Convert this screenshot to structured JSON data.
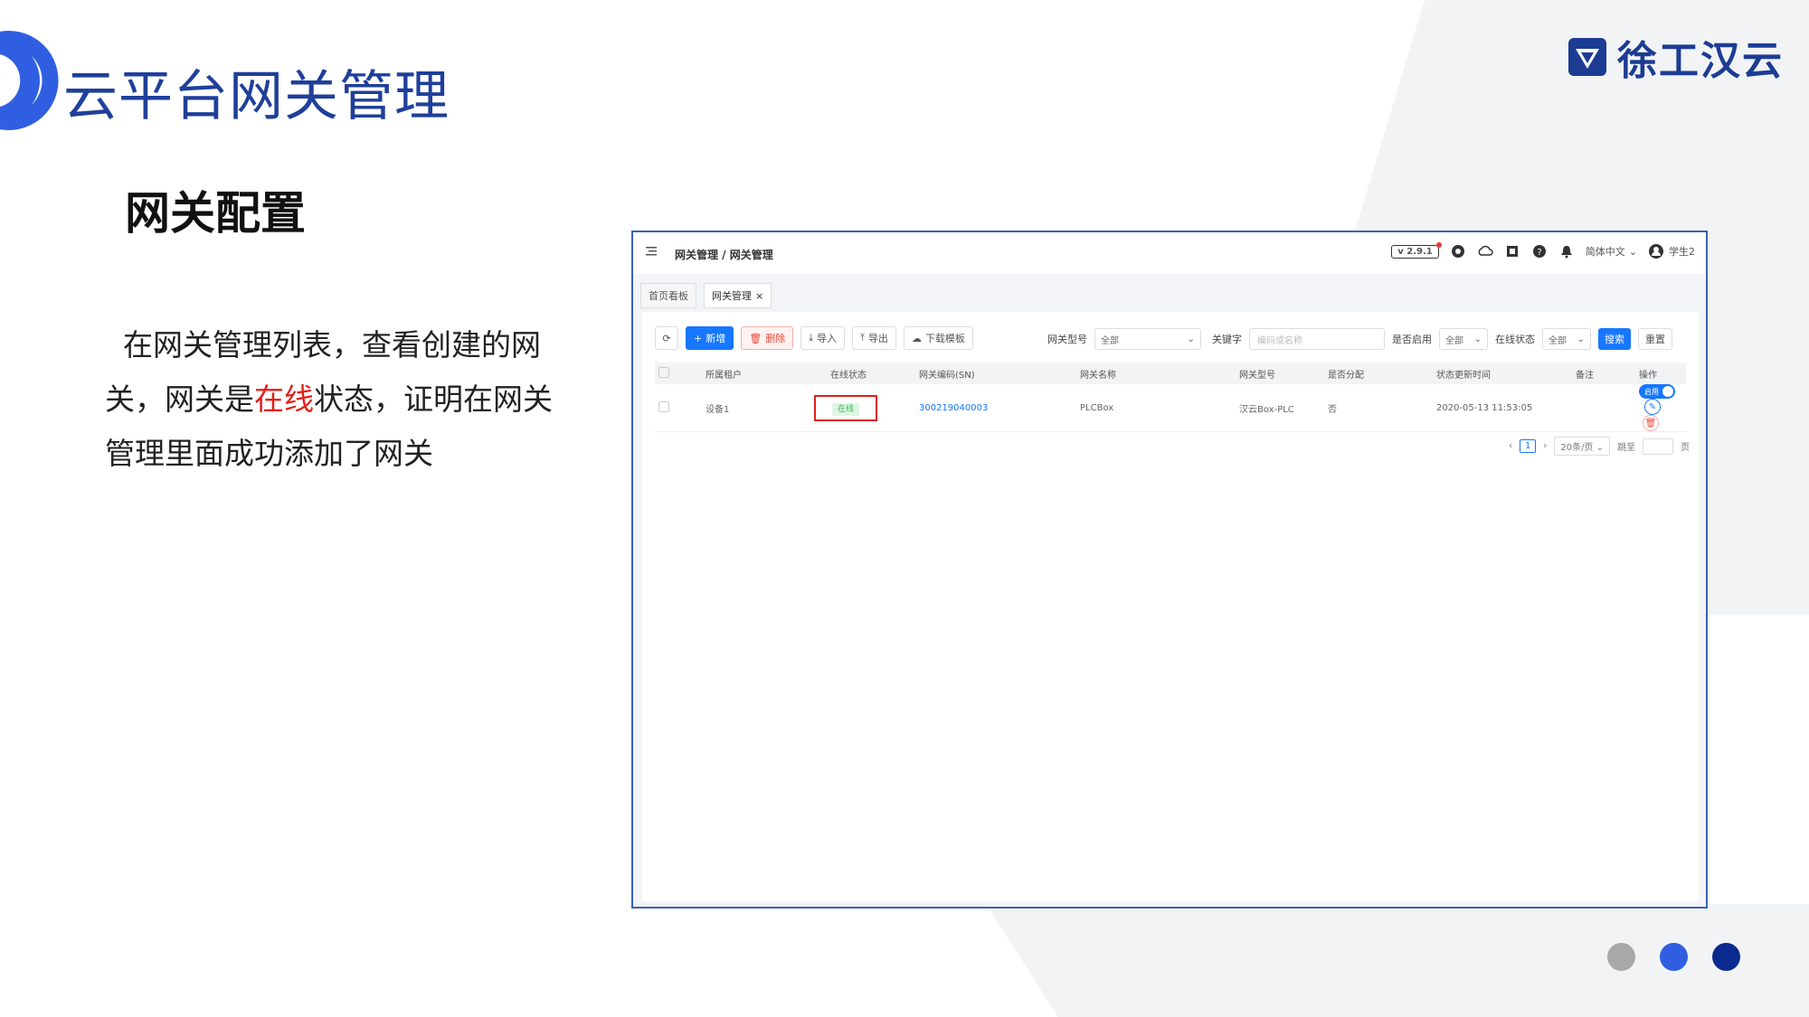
{
  "slide": {
    "title": "云平台网关管理",
    "brand": "徐工汉云",
    "section_heading": "网关配置",
    "body_before": "在网关管理列表，查看创建的网关，网关是",
    "body_highlight": "在线",
    "body_after": "状态，证明在网关管理里面成功添加了网关",
    "colors": {
      "accent": "#2f5fe0",
      "title": "#1f3f9a",
      "highlight": "#e0201a",
      "dot_gray": "#a8a8a8",
      "dot_blue": "#2f5fe0",
      "dot_navy": "#0b2a8f"
    }
  },
  "app": {
    "breadcrumb": "网关管理 / 网关管理",
    "version": "v 2.9.1",
    "language": "简体中文",
    "user": "学生2",
    "tabs": [
      {
        "label": "首页看板"
      },
      {
        "label": "网关管理"
      }
    ],
    "toolbar": {
      "add": "新增",
      "delete": "删除",
      "import": "导入",
      "export": "导出",
      "download_template": "下载模板"
    },
    "filters": {
      "model_label": "网关型号",
      "model_value": "全部",
      "keyword_label": "关键字",
      "keyword_placeholder": "编码或名称",
      "enabled_label": "是否启用",
      "enabled_value": "全部",
      "online_label": "在线状态",
      "online_value": "全部",
      "search": "搜索",
      "reset": "重置"
    },
    "table": {
      "headers": [
        "所属租户",
        "在线状态",
        "网关编码(SN)",
        "网关名称",
        "网关型号",
        "是否分配",
        "状态更新时间",
        "备注",
        "操作"
      ],
      "rows": [
        {
          "tenant": "设备1",
          "status": "在线",
          "sn": "300219040003",
          "name": "PLCBox",
          "model": "汉云Box-PLC",
          "assigned": "否",
          "updated": "2020-05-13 11:53:05",
          "remark": "",
          "toggle": "启用"
        }
      ]
    },
    "pagination": {
      "page": "1",
      "page_size": "20条/页",
      "goto_label": "跳至",
      "page_suffix": "页"
    }
  }
}
